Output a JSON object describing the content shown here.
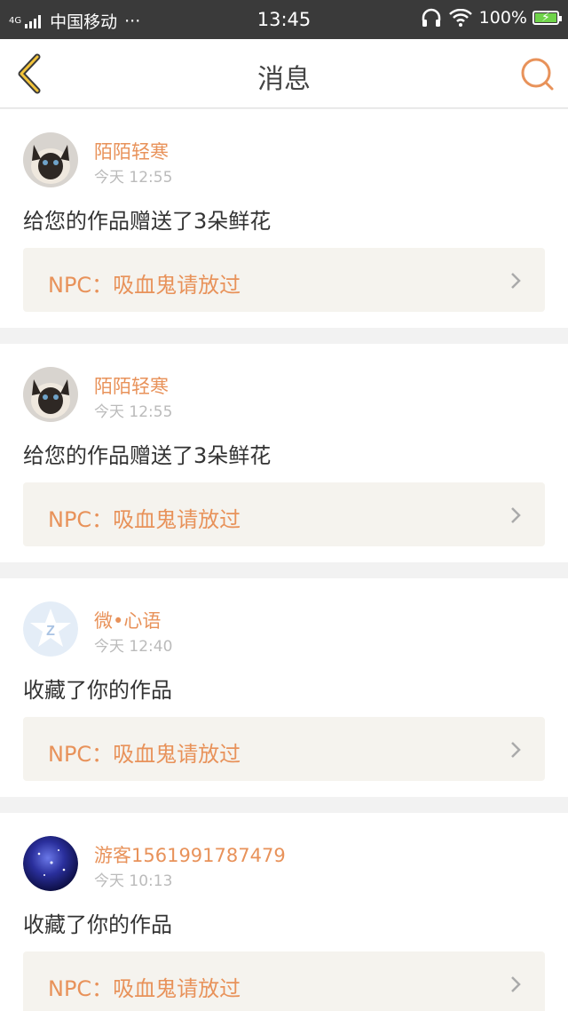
{
  "status_bar": {
    "network": "4G",
    "carrier": "中国移动",
    "more": "···",
    "time": "13:45",
    "battery": "100%"
  },
  "nav": {
    "title": "消息",
    "back_icon": "chevron-left-icon",
    "search_icon": "search-icon",
    "accent": "#e8925a"
  },
  "messages": [
    {
      "user": "陌陌轻寒",
      "time": "今天 12:55",
      "action": "给您的作品赠送了3朵鲜花",
      "work": "NPC：吸血鬼请放过",
      "avatar": "cat-avatar"
    },
    {
      "user": "陌陌轻寒",
      "time": "今天 12:55",
      "action": "给您的作品赠送了3朵鲜花",
      "work": "NPC：吸血鬼请放过",
      "avatar": "cat-avatar"
    },
    {
      "user": "微•心语",
      "time": "今天 12:40",
      "action": "收藏了你的作品",
      "work": "NPC：吸血鬼请放过",
      "avatar": "default-avatar"
    },
    {
      "user": "游客1561991787479",
      "time": "今天 10:13",
      "action": "收藏了你的作品",
      "work": "NPC：吸血鬼请放过",
      "avatar": "galaxy-avatar"
    }
  ]
}
